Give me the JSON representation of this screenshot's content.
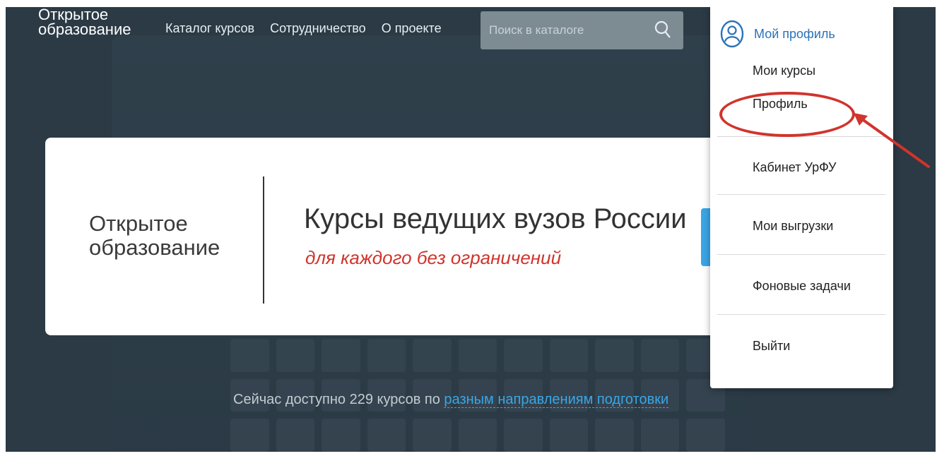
{
  "header": {
    "logo": {
      "line1": "Открытое",
      "line2": "образование"
    },
    "nav": [
      {
        "label": "Каталог курсов"
      },
      {
        "label": "Сотрудничество"
      },
      {
        "label": "О проекте"
      }
    ],
    "search": {
      "placeholder": "Поиск в каталоге"
    }
  },
  "hero": {
    "logo": {
      "line1": "Открытое",
      "line2": "образование"
    },
    "headline": "Курсы ведущих вузов России",
    "tagline": "для каждого без ограничений"
  },
  "footer": {
    "text": "Сейчас доступно 229 курсов по ",
    "link": "разным направлениям подготовки"
  },
  "profile_menu": {
    "title": "Мой профиль",
    "items": [
      {
        "label": "Мои курсы"
      },
      {
        "label": "Профиль"
      },
      {
        "label": "Кабинет УрФУ"
      },
      {
        "label": "Мои выгрузки"
      },
      {
        "label": "Фоновые задачи"
      },
      {
        "label": "Выйти"
      }
    ]
  },
  "colors": {
    "accent": "#3aa6e6",
    "highlight": "#d0342c",
    "link": "#2a72b8"
  }
}
